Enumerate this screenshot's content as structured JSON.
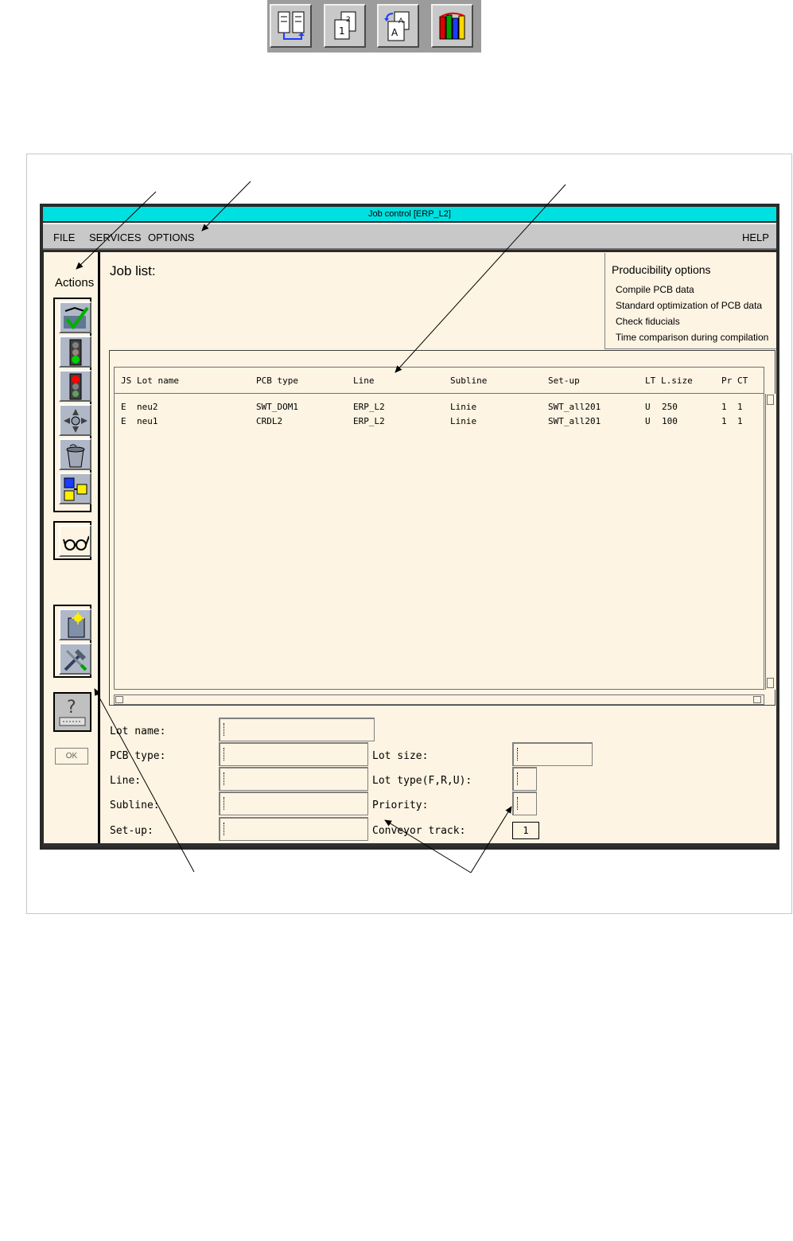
{
  "toolbar": {
    "icons": [
      "split-view-icon",
      "copy-pages-icon",
      "transfer-document-icon",
      "library-books-icon"
    ]
  },
  "window": {
    "title": "Job control [ERP_L2]"
  },
  "menu": {
    "file": "FILE",
    "services": "SERVICES",
    "options": "OPTIONS",
    "help": "HELP"
  },
  "actions": {
    "title": "Actions",
    "ok_label": "OK",
    "icons": [
      "approve-checkmark-icon",
      "traffic-light-green-icon",
      "traffic-light-red-icon",
      "move-arrows-icon",
      "trash-bin-icon",
      "assign-blocks-icon",
      "view-glasses-icon",
      "new-document-icon",
      "tools-icon",
      "help-keyboard-icon"
    ]
  },
  "job_list": {
    "title": "Job list:",
    "columns": [
      "JS",
      "Lot name",
      "PCB type",
      "Line",
      "Subline",
      "Set-up",
      "LT",
      "L.size",
      "Pr",
      "CT"
    ],
    "rows": [
      [
        "E",
        "neu2",
        "SWT_DOM1",
        "ERP_L2",
        "Linie",
        "SWT_all201",
        "U",
        "250",
        "1",
        "1"
      ],
      [
        "E",
        "neu1",
        "CRDL2",
        "ERP_L2",
        "Linie",
        "SWT_all201",
        "U",
        "100",
        "1",
        "1"
      ]
    ]
  },
  "producibility": {
    "title": "Producibility options",
    "items": [
      "Compile PCB data",
      "Standard optimization of PCB data",
      "Check fiducials",
      "Time comparison during compilation"
    ]
  },
  "form": {
    "lot_name_label": "Lot name:",
    "pcb_type_label": "PCB type:",
    "line_label": "Line:",
    "subline_label": "Subline:",
    "setup_label": "Set-up:",
    "lot_size_label": "Lot size:",
    "lot_type_label": "Lot type(F,R,U):",
    "priority_label": "Priority:",
    "conveyor_label": "Conveyor track:",
    "lot_name_value": "",
    "pcb_type_value": "",
    "line_value": "",
    "subline_value": "",
    "setup_value": "",
    "lot_size_value": "",
    "lot_type_value": "",
    "priority_value": "",
    "conveyor_value": "1"
  },
  "colors": {
    "title_bar": "#00e0e0",
    "panel_bg": "#fdf4e3",
    "menu_bg": "#c8c8c8"
  }
}
